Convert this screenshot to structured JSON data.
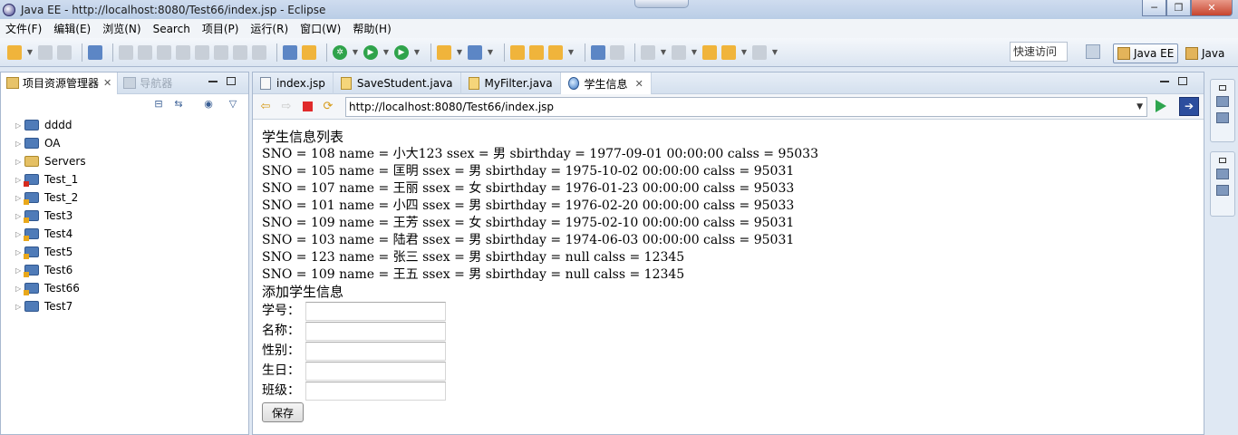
{
  "window": {
    "title": "Java EE - http://localhost:8080/Test66/index.jsp - Eclipse",
    "minimize": "─",
    "maximize": "❐",
    "close": "✕"
  },
  "menubar": [
    "文件(F)",
    "编辑(E)",
    "浏览(N)",
    "Search",
    "项目(P)",
    "运行(R)",
    "窗口(W)",
    "帮助(H)"
  ],
  "toolbar": {
    "quick_access": "快速访问",
    "perspectives": [
      "Java EE",
      "Java"
    ]
  },
  "left_panel": {
    "tabs": [
      {
        "label": "项目资源管理器",
        "close": "✕"
      },
      {
        "label": "导航器"
      }
    ],
    "projects": [
      {
        "name": "dddd",
        "type": "project",
        "marker": ""
      },
      {
        "name": "OA",
        "type": "project",
        "marker": ""
      },
      {
        "name": "Servers",
        "type": "folder",
        "marker": ""
      },
      {
        "name": "Test_1",
        "type": "project",
        "marker": "error"
      },
      {
        "name": "Test_2",
        "type": "project",
        "marker": "warning"
      },
      {
        "name": "Test3",
        "type": "project",
        "marker": "warning"
      },
      {
        "name": "Test4",
        "type": "project",
        "marker": "warning"
      },
      {
        "name": "Test5",
        "type": "project",
        "marker": "warning"
      },
      {
        "name": "Test6",
        "type": "project",
        "marker": "warning"
      },
      {
        "name": "Test66",
        "type": "project",
        "marker": "warning"
      },
      {
        "name": "Test7",
        "type": "project",
        "marker": ""
      }
    ]
  },
  "editor": {
    "tabs": [
      {
        "label": "index.jsp",
        "icon": "jsp"
      },
      {
        "label": "SaveStudent.java",
        "icon": "java"
      },
      {
        "label": "MyFilter.java",
        "icon": "java"
      },
      {
        "label": "学生信息",
        "icon": "globe",
        "active": true,
        "close": "✕"
      }
    ],
    "url": "http://localhost:8080/Test66/index.jsp",
    "url_dropdown": "▼"
  },
  "page": {
    "heading": "学生信息列表",
    "students": [
      "SNO = 108 name = 小大123 ssex = 男 sbirthday = 1977-09-01 00:00:00 calss = 95033",
      "SNO = 105 name = 匡明 ssex = 男 sbirthday = 1975-10-02 00:00:00 calss = 95031",
      "SNO = 107 name = 王丽 ssex = 女 sbirthday = 1976-01-23 00:00:00 calss = 95033",
      "SNO = 101 name = 小四 ssex = 男 sbirthday = 1976-02-20 00:00:00 calss = 95033",
      "SNO = 109 name = 王芳 ssex = 女 sbirthday = 1975-02-10 00:00:00 calss = 95031",
      "SNO = 103 name = 陆君 ssex = 男 sbirthday = 1974-06-03 00:00:00 calss = 95031",
      "SNO = 123 name = 张三 ssex = 男 sbirthday = null calss = 12345",
      "SNO = 109 name = 王五 ssex = 男 sbirthday = null calss = 12345"
    ],
    "form_title": "添加学生信息",
    "fields": [
      {
        "label": "学号：",
        "value": ""
      },
      {
        "label": "名称：",
        "value": ""
      },
      {
        "label": "性别：",
        "value": ""
      },
      {
        "label": "生日：",
        "value": ""
      },
      {
        "label": "班级：",
        "value": ""
      }
    ],
    "submit": "保存"
  }
}
